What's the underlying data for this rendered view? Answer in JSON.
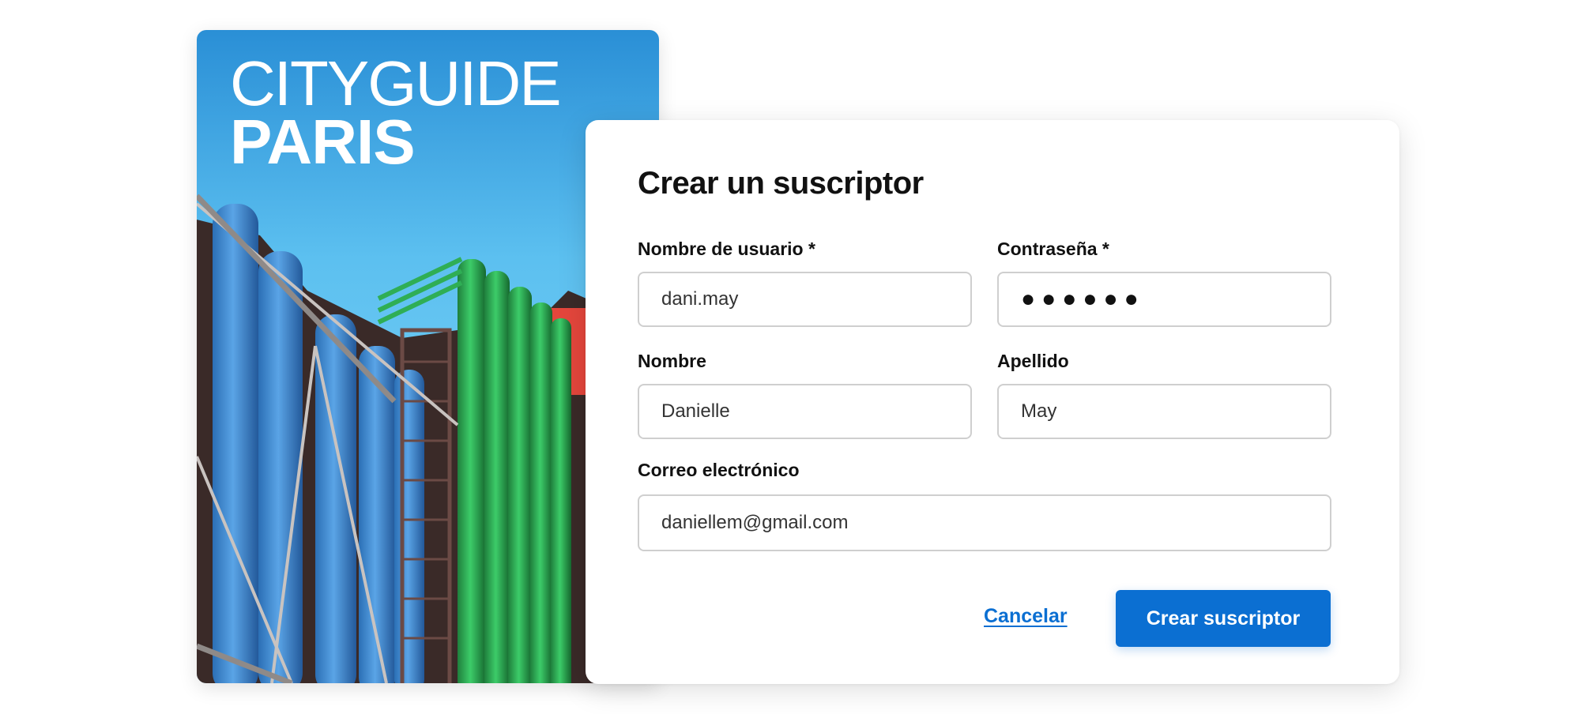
{
  "poster": {
    "line1": "CITYGUIDE",
    "line2": "PARIS",
    "colors": {
      "sky_top": "#2a8fd6",
      "sky_bottom": "#7fd3f5",
      "blue_pipes": "#3f8ed8",
      "green_pipes": "#2fae55",
      "red_panel": "#e4463c"
    }
  },
  "form": {
    "title": "Crear un suscriptor",
    "username": {
      "label": "Nombre de usuario *",
      "value": "dani.may"
    },
    "password": {
      "label": "Contraseña *",
      "value": "●●●●●●"
    },
    "first_name": {
      "label": "Nombre",
      "value": "Danielle"
    },
    "last_name": {
      "label": "Apellido",
      "value": "May"
    },
    "email": {
      "label": "Correo electrónico",
      "value": "daniellem@gmail.com"
    },
    "cancel_label": "Cancelar",
    "submit_label": "Crear suscriptor"
  },
  "colors": {
    "accent": "#0b6fd2",
    "input_border": "#cfcfcf",
    "text": "#111111"
  }
}
